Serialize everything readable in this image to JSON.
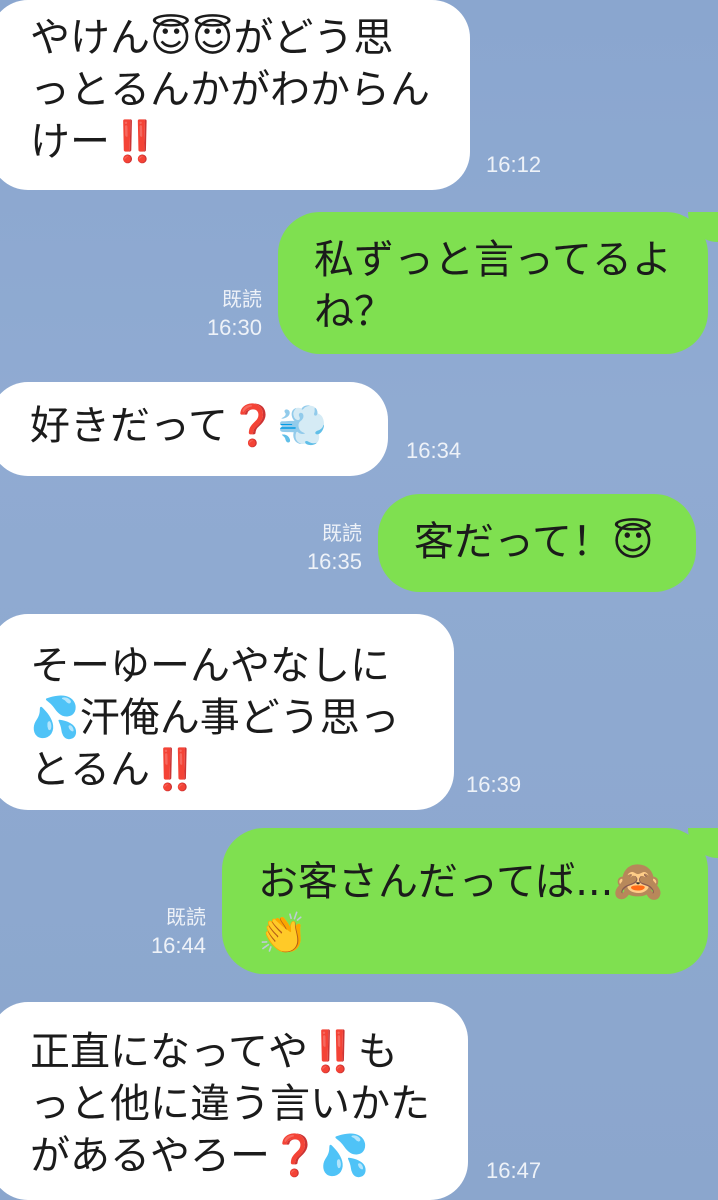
{
  "messages": [
    {
      "side": "in",
      "lines": [
        "やけん😇😇がどう思",
        "っとるんかがわからん",
        "けー‼️"
      ],
      "time": "16:12"
    },
    {
      "side": "out",
      "lines": [
        "私ずっと言ってるよ",
        "ね？"
      ],
      "read": "既読",
      "time": "16:30"
    },
    {
      "side": "in",
      "lines": [
        "好きだって❓💨"
      ],
      "time": "16:34"
    },
    {
      "side": "out",
      "lines": [
        "客だって！😇"
      ],
      "read": "既読",
      "time": "16:35"
    },
    {
      "side": "in",
      "lines": [
        "そーゆーんやなしに",
        "💦汗俺ん事どう思っ",
        "とるん‼️"
      ],
      "time": "16:39"
    },
    {
      "side": "out",
      "lines": [
        "お客さんだってば...🙈",
        "👏"
      ],
      "read": "既読",
      "time": "16:44"
    },
    {
      "side": "in",
      "lines": [
        "正直になってや‼️も",
        "っと他に違う言いかた",
        "があるやろー❓💦"
      ],
      "time": "16:47"
    }
  ],
  "colors": {
    "background": "#8ea9d0",
    "incoming_bubble": "#ffffff",
    "outgoing_bubble": "#7fe050",
    "meta_text": "#eef2f8",
    "emphasis_red": "#e8262a"
  }
}
